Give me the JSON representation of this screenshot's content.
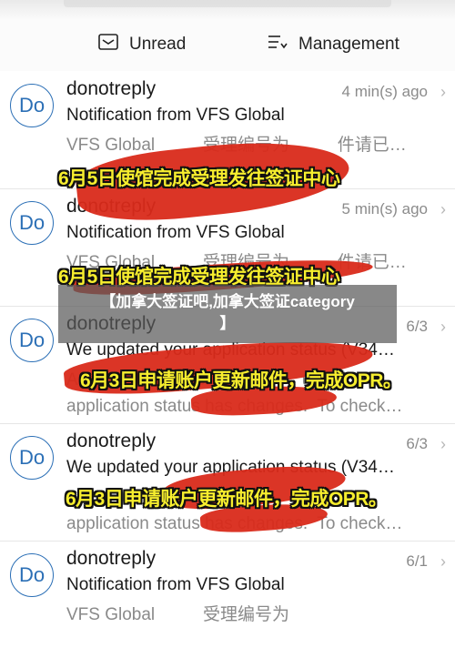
{
  "toolbar": {
    "unread_label": "Unread",
    "management_label": "Management"
  },
  "emails": [
    {
      "avatar": "Do",
      "sender": "donotreply",
      "time": "4 min(s) ago",
      "subject": "Notification from VFS Global",
      "preview": "VFS Global          受理编号为          件请已…"
    },
    {
      "avatar": "Do",
      "sender": "donotreply",
      "time": "5 min(s) ago",
      "subject": "Notification from VFS Global",
      "preview": "VFS Global          受理编号为          件请已…"
    },
    {
      "avatar": "Do",
      "sender": "donotreply",
      "time": "6/3",
      "subject": "We updated your application status (V34…",
      "preview": "A                     ation                  ur\napplication status has changes.  To check…"
    },
    {
      "avatar": "Do",
      "sender": "donotreply",
      "time": "6/3",
      "subject": "We updated your application status (V34…",
      "preview": "A                     ation                  ur\napplication status has changes.  To check…"
    },
    {
      "avatar": "Do",
      "sender": "donotreply",
      "time": "6/1",
      "subject": "Notification from VFS Global",
      "preview": "VFS Global          受理编号为"
    }
  ],
  "captions": {
    "c1": "6月5日使馆完成受理发往签证中心",
    "c2": "6月5日使馆完成受理发往签证中心",
    "c3": "6月3日申请账户更新邮件，完成OPR。",
    "c4": "6月3日申请账户更新邮件，完成OPR。"
  },
  "banner": {
    "line1": "【加拿大签证吧,加拿大签证category",
    "line2": "】"
  },
  "colors": {
    "accent": "#2b6fb6",
    "redact": "#d92a1a",
    "caption": "#f7ee2e"
  }
}
